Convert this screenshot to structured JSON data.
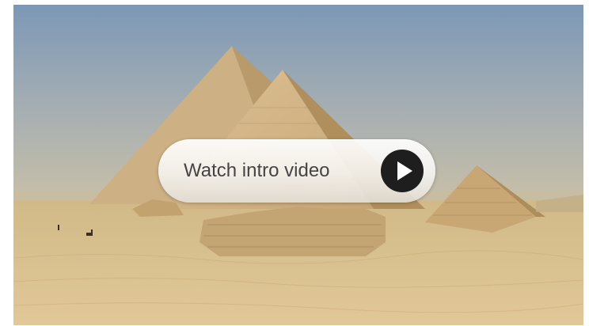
{
  "video": {
    "cta_label": "Watch intro video",
    "play_icon": "play-icon"
  },
  "colors": {
    "sky_top": "#7e9ab7",
    "sky_horizon": "#c7c1ac",
    "sand": "#d8bf8e",
    "pyramid_lit": "#d6b783",
    "pyramid_shadow": "#b49462",
    "play_button": "#1e1e1e",
    "label_text": "#444444"
  }
}
